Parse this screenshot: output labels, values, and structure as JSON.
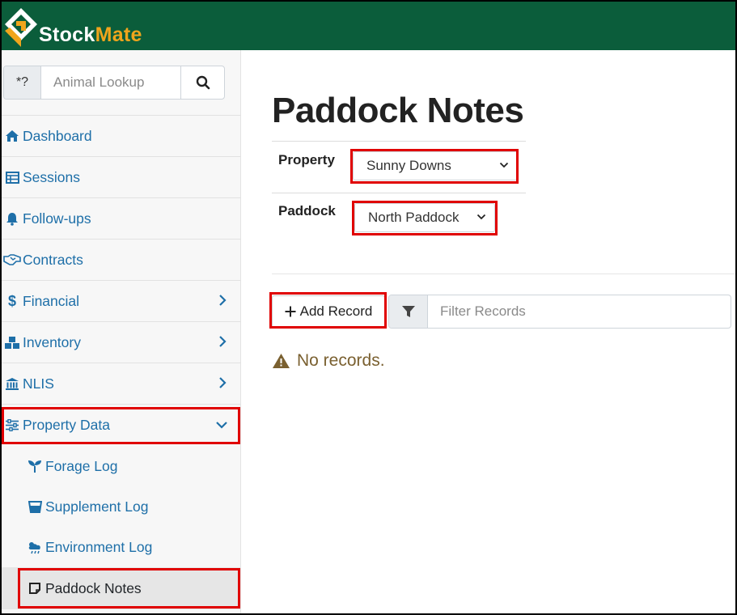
{
  "brand": {
    "part1": "Stock",
    "part2": "Mate",
    "accent": "#f0a51c",
    "header_bg": "#0b5d3b"
  },
  "lookup": {
    "prefix": "*?",
    "placeholder": "Animal Lookup"
  },
  "nav": [
    {
      "label": "Dashboard",
      "icon": "home-icon"
    },
    {
      "label": "Sessions",
      "icon": "table-icon"
    },
    {
      "label": "Follow-ups",
      "icon": "bell-icon"
    },
    {
      "label": "Contracts",
      "icon": "handshake-icon"
    },
    {
      "label": "Financial",
      "icon": "dollar-icon"
    },
    {
      "label": "Inventory",
      "icon": "boxes-icon"
    },
    {
      "label": "NLIS",
      "icon": "bank-icon"
    },
    {
      "label": "Property Data",
      "icon": "sliders-icon"
    }
  ],
  "subnav": [
    {
      "label": "Forage Log",
      "icon": "seedling-icon"
    },
    {
      "label": "Supplement Log",
      "icon": "bucket-icon"
    },
    {
      "label": "Environment Log",
      "icon": "cloud-rain-icon"
    },
    {
      "label": "Paddock Notes",
      "icon": "note-icon"
    }
  ],
  "page": {
    "title": "Paddock Notes",
    "property_label": "Property",
    "property_value": "Sunny Downs",
    "paddock_label": "Paddock",
    "paddock_value": "North Paddock",
    "add_label": "Add Record",
    "filter_placeholder": "Filter Records",
    "empty_text": "No records."
  },
  "colors": {
    "link": "#1e6fa8",
    "highlight": "#e00000",
    "warning": "#7a6030"
  }
}
